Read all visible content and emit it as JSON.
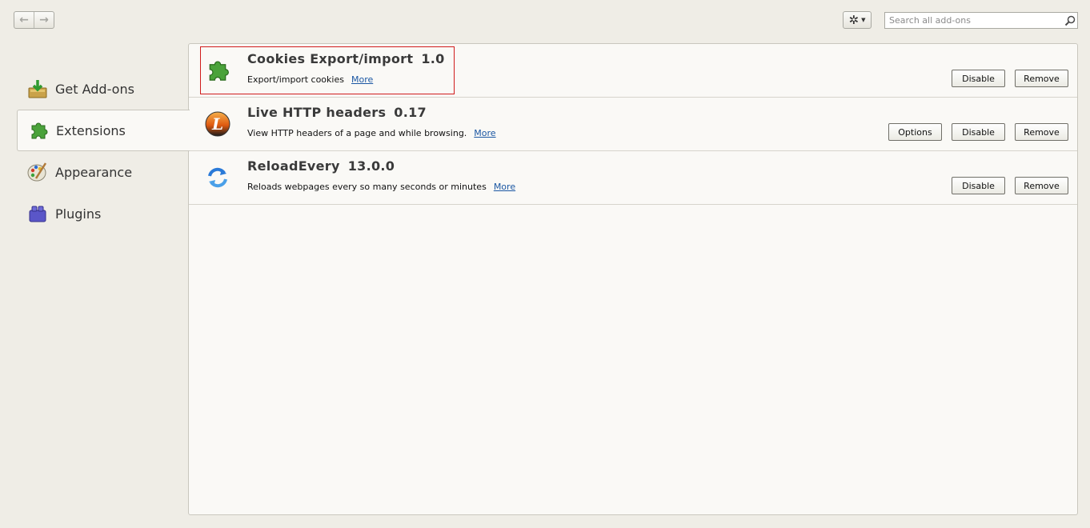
{
  "toolbar": {
    "back_glyph": "←",
    "forward_glyph": "→",
    "tools_icon": "gear-icon",
    "tools_glyph": "✲",
    "tools_caret": "▼",
    "search_placeholder": "Search all add-ons"
  },
  "sidebar": {
    "items": [
      {
        "label": "Get Add-ons",
        "icon": "download-box-icon",
        "selected": false
      },
      {
        "label": "Extensions",
        "icon": "puzzle-piece-icon",
        "selected": true
      },
      {
        "label": "Appearance",
        "icon": "palette-brush-icon",
        "selected": false
      },
      {
        "label": "Plugins",
        "icon": "lego-brick-icon",
        "selected": false
      }
    ]
  },
  "addons": [
    {
      "name": "Cookies Export/import",
      "version": "1.0",
      "description": "Export/import cookies",
      "more_label": "More",
      "icon": "puzzle-piece-icon",
      "buttons": {
        "disable": "Disable",
        "remove": "Remove"
      },
      "highlighted": true
    },
    {
      "name": "Live HTTP headers",
      "version": "0.17",
      "description": "View HTTP headers of a page and while browsing.",
      "more_label": "More",
      "icon": "live-http-headers-icon",
      "buttons": {
        "options": "Options",
        "disable": "Disable",
        "remove": "Remove"
      }
    },
    {
      "name": "ReloadEvery",
      "version": "13.0.0",
      "description": "Reloads webpages every so many seconds or minutes",
      "more_label": "More",
      "icon": "reload-icon",
      "buttons": {
        "disable": "Disable",
        "remove": "Remove"
      }
    }
  ],
  "colors": {
    "highlight": "#d01c1c",
    "link": "#1b57a3"
  }
}
